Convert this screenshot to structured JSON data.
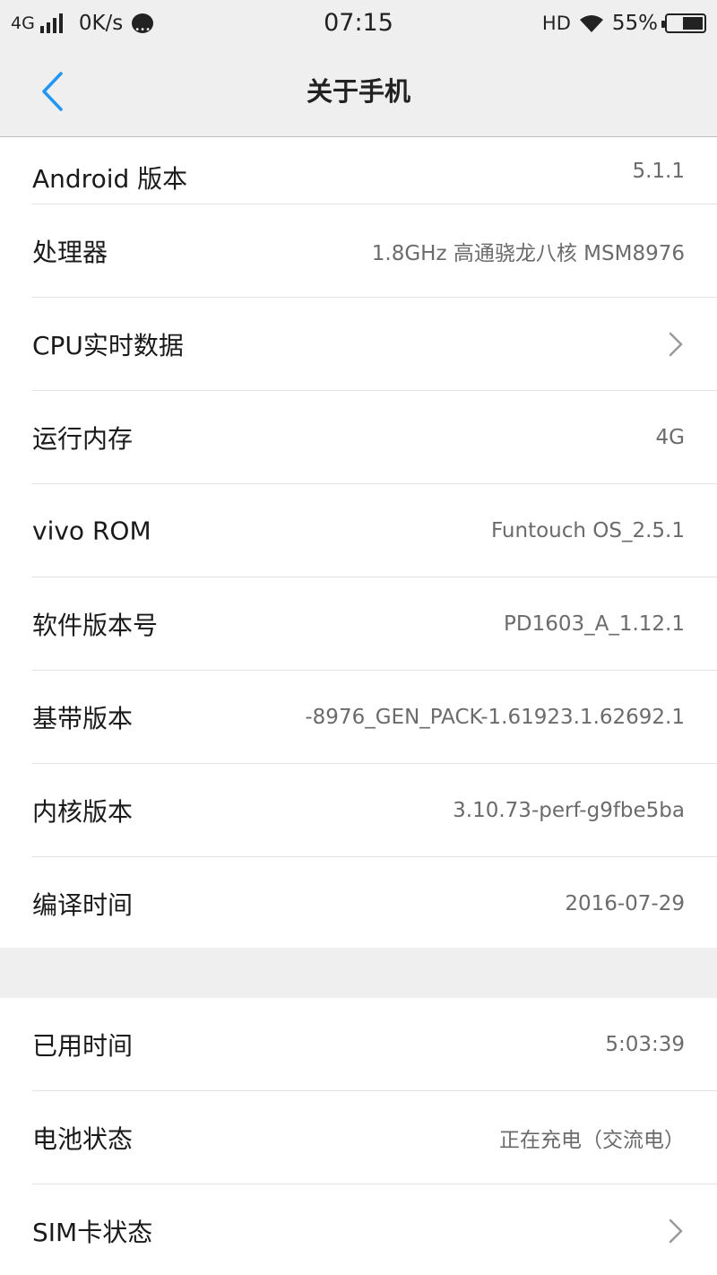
{
  "status_bar": {
    "network": "4G",
    "speed": "0K/s",
    "time": "07:15",
    "hd": "HD",
    "battery": "55%",
    "icons": [
      "signal-icon",
      "chat-icon",
      "wifi-icon",
      "battery-icon"
    ]
  },
  "nav": {
    "title": "关于手机",
    "back_icon": "chevron-left-icon",
    "accent": "#2196f3"
  },
  "section1": [
    {
      "label": "Android 版本",
      "value": "5.1.1"
    },
    {
      "label": "处理器",
      "value": "1.8GHz 高通骁龙八核 MSM8976"
    },
    {
      "label": "CPU实时数据",
      "value": ""
    },
    {
      "label": "运行内存",
      "value": "4G"
    },
    {
      "label": "vivo ROM",
      "value": "Funtouch OS_2.5.1"
    },
    {
      "label": "软件版本号",
      "value": "PD1603_A_1.12.1"
    },
    {
      "label": "基带版本",
      "value": "-8976_GEN_PACK-1.61923.1.62692.1"
    },
    {
      "label": "内核版本",
      "value": "3.10.73-perf-g9fbe5ba"
    },
    {
      "label": "编译时间",
      "value": "2016-07-29"
    }
  ],
  "section2": [
    {
      "label": "已用时间",
      "value": "5:03:39"
    },
    {
      "label": "电池状态",
      "value": "正在充电（交流电）"
    },
    {
      "label": "SIM卡状态",
      "value": ""
    }
  ]
}
